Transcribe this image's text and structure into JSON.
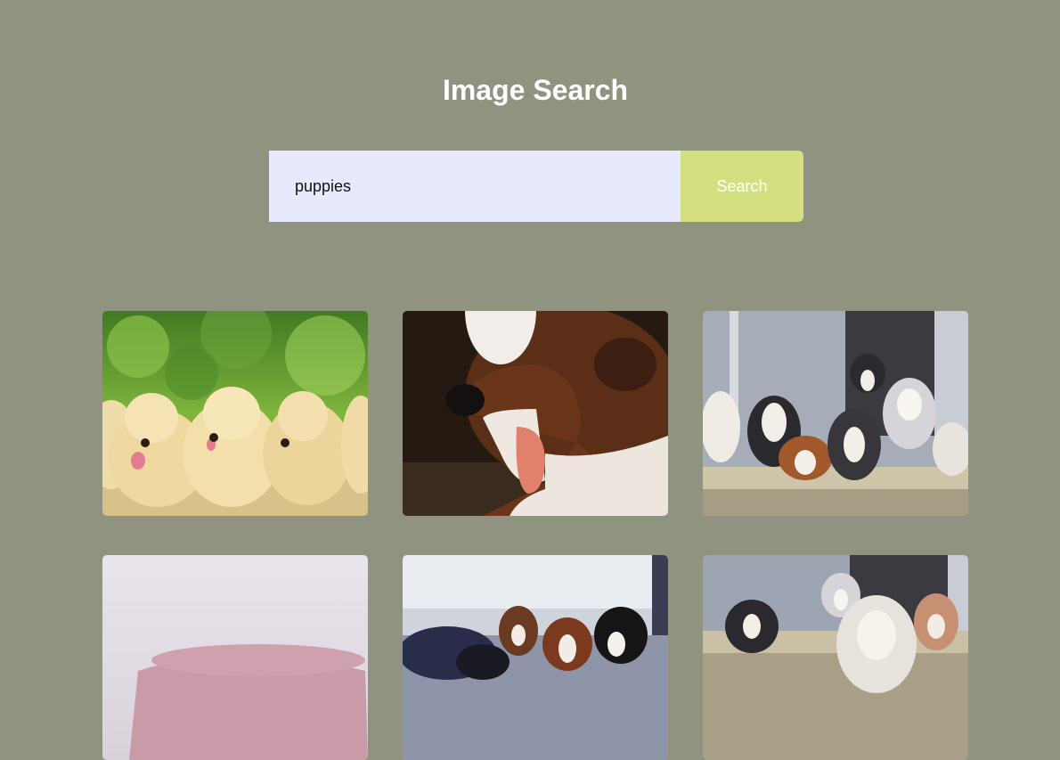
{
  "header": {
    "title": "Image Search"
  },
  "search": {
    "value": "puppies",
    "button_label": "Search"
  },
  "results": [
    {
      "subject": "golden retriever puppies in a row"
    },
    {
      "subject": "yawning brown and white puppy"
    },
    {
      "subject": "australian shepherd puppies on a step"
    },
    {
      "subject": "puppy on a pink pillow"
    },
    {
      "subject": "brown and black puppies cuddling"
    },
    {
      "subject": "australian shepherd puppies by a door"
    }
  ]
}
